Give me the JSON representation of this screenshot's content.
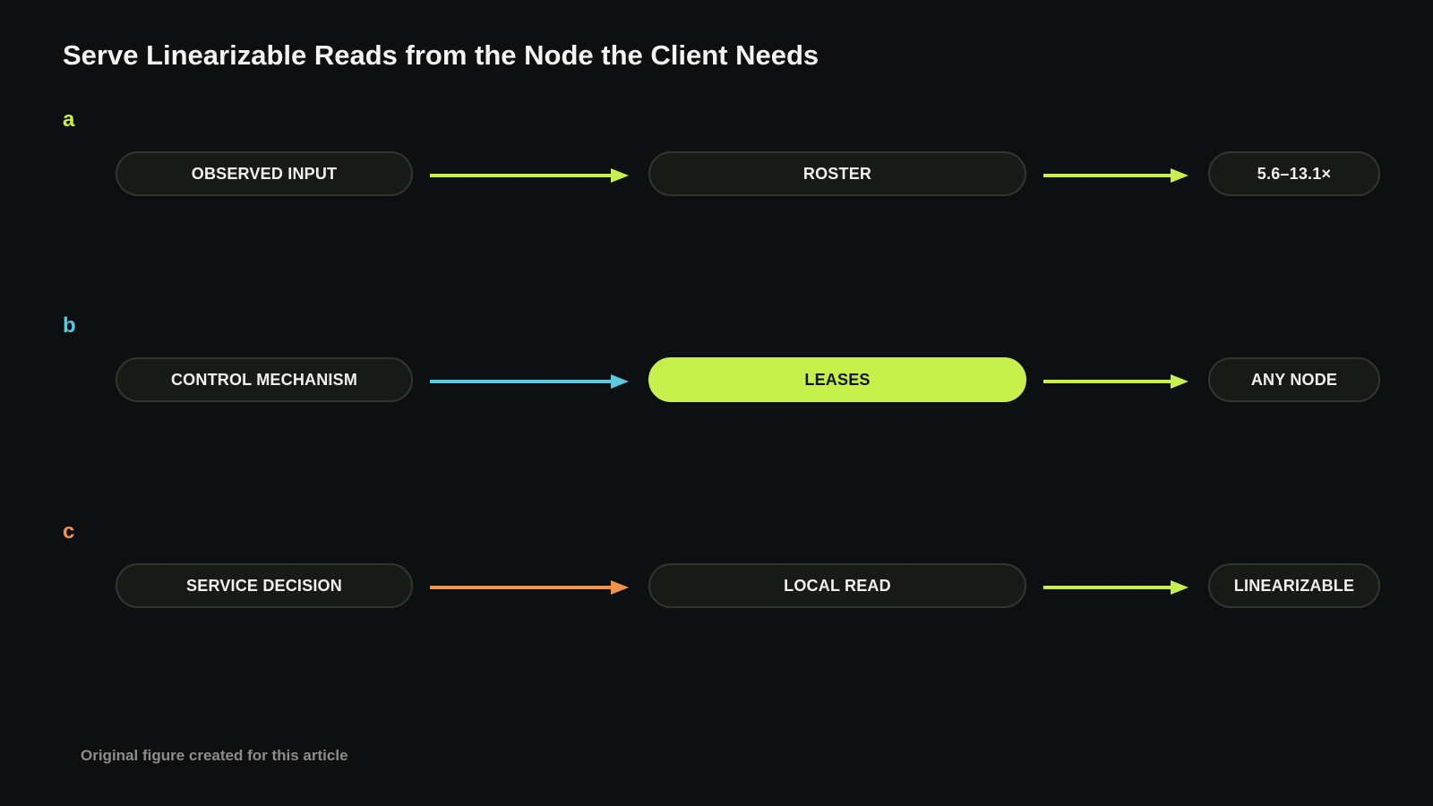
{
  "title": "Serve Linearizable Reads from the Node the Client Needs",
  "colors": {
    "background": "#0e0f11",
    "lime": "#c8f04c",
    "cyan": "#5cc7de",
    "orange": "#f0944c",
    "pill_fill": "#181a17",
    "pill_border": "#33362f"
  },
  "rows": [
    {
      "letter": "a",
      "letter_color": "#c8f04c",
      "nodes": [
        "OBSERVED INPUT",
        "ROSTER",
        "5.6–13.1×"
      ],
      "arrow_colors": [
        "#c8f04c",
        "#c8f04c"
      ],
      "highlighted_node": null
    },
    {
      "letter": "b",
      "letter_color": "#5cc7de",
      "nodes": [
        "CONTROL MECHANISM",
        "LEASES",
        "ANY NODE"
      ],
      "arrow_colors": [
        "#5cc7de",
        "#c8f04c"
      ],
      "highlighted_node": 1
    },
    {
      "letter": "c",
      "letter_color": "#f0944c",
      "nodes": [
        "SERVICE DECISION",
        "LOCAL READ",
        "LINEARIZABLE"
      ],
      "arrow_colors": [
        "#f0944c",
        "#c8f04c"
      ],
      "highlighted_node": null
    }
  ],
  "footer": "Original figure created for this article"
}
